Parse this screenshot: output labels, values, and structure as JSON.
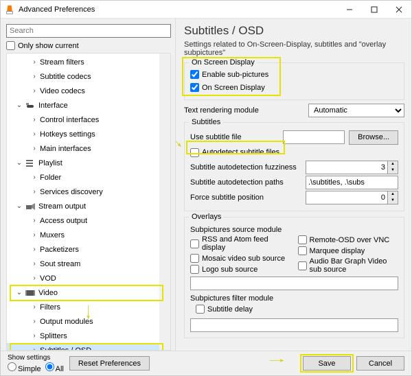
{
  "window": {
    "title": "Advanced Preferences"
  },
  "left": {
    "search_placeholder": "Search",
    "only_show_current": "Only show current",
    "tree": [
      {
        "kind": "leaf",
        "level": 2,
        "label": "Stream filters"
      },
      {
        "kind": "leaf",
        "level": 2,
        "label": "Subtitle codecs"
      },
      {
        "kind": "leaf",
        "level": 2,
        "label": "Video codecs"
      },
      {
        "kind": "branch",
        "level": 1,
        "expanded": true,
        "label": "Interface",
        "icon": "interface"
      },
      {
        "kind": "leaf",
        "level": 2,
        "label": "Control interfaces"
      },
      {
        "kind": "leaf",
        "level": 2,
        "label": "Hotkeys settings"
      },
      {
        "kind": "leaf",
        "level": 2,
        "label": "Main interfaces"
      },
      {
        "kind": "branch",
        "level": 1,
        "expanded": true,
        "label": "Playlist",
        "icon": "playlist"
      },
      {
        "kind": "leaf",
        "level": 2,
        "label": "Folder"
      },
      {
        "kind": "leaf",
        "level": 2,
        "label": "Services discovery"
      },
      {
        "kind": "branch",
        "level": 1,
        "expanded": true,
        "label": "Stream output",
        "icon": "stream"
      },
      {
        "kind": "leaf",
        "level": 2,
        "label": "Access output"
      },
      {
        "kind": "leaf",
        "level": 2,
        "label": "Muxers"
      },
      {
        "kind": "leaf",
        "level": 2,
        "label": "Packetizers"
      },
      {
        "kind": "leaf",
        "level": 2,
        "label": "Sout stream"
      },
      {
        "kind": "leaf",
        "level": 2,
        "label": "VOD"
      },
      {
        "kind": "branch",
        "level": 1,
        "expanded": true,
        "label": "Video",
        "icon": "video"
      },
      {
        "kind": "leaf",
        "level": 2,
        "label": "Filters"
      },
      {
        "kind": "leaf",
        "level": 2,
        "label": "Output modules"
      },
      {
        "kind": "leaf",
        "level": 2,
        "label": "Splitters"
      },
      {
        "kind": "leaf",
        "level": 2,
        "label": "Subtitles / OSD",
        "selected": true
      }
    ]
  },
  "right": {
    "title": "Subtitles / OSD",
    "desc": "Settings related to On-Screen-Display, subtitles and \"overlay subpictures\"",
    "group_osd": {
      "title": "On Screen Display",
      "enable_sub": "Enable sub-pictures",
      "osd": "On Screen Display",
      "text_render_label": "Text rendering module",
      "text_render_value": "Automatic"
    },
    "group_subs": {
      "title": "Subtitles",
      "use_subtitle_file": "Use subtitle file",
      "browse": "Browse...",
      "autodetect": "Autodetect subtitle files",
      "fuzz_label": "Subtitle autodetection fuzziness",
      "fuzz_value": "3",
      "paths_label": "Subtitle autodetection paths",
      "paths_value": ".\\subtitles, .\\subs",
      "force_label": "Force subtitle position",
      "force_value": "0"
    },
    "group_ov": {
      "title": "Overlays",
      "src_module": "Subpictures source module",
      "src_options_left": [
        "RSS and Atom feed display",
        "Mosaic video sub source",
        "Logo sub source"
      ],
      "src_options_right": [
        "Remote-OSD over VNC",
        "Marquee display",
        "Audio Bar Graph Video sub source"
      ],
      "filter_module": "Subpictures filter module",
      "subtitle_delay": "Subtitle delay"
    }
  },
  "footer": {
    "show_settings": "Show settings",
    "simple": "Simple",
    "all": "All",
    "reset": "Reset Preferences",
    "save": "Save",
    "cancel": "Cancel"
  }
}
